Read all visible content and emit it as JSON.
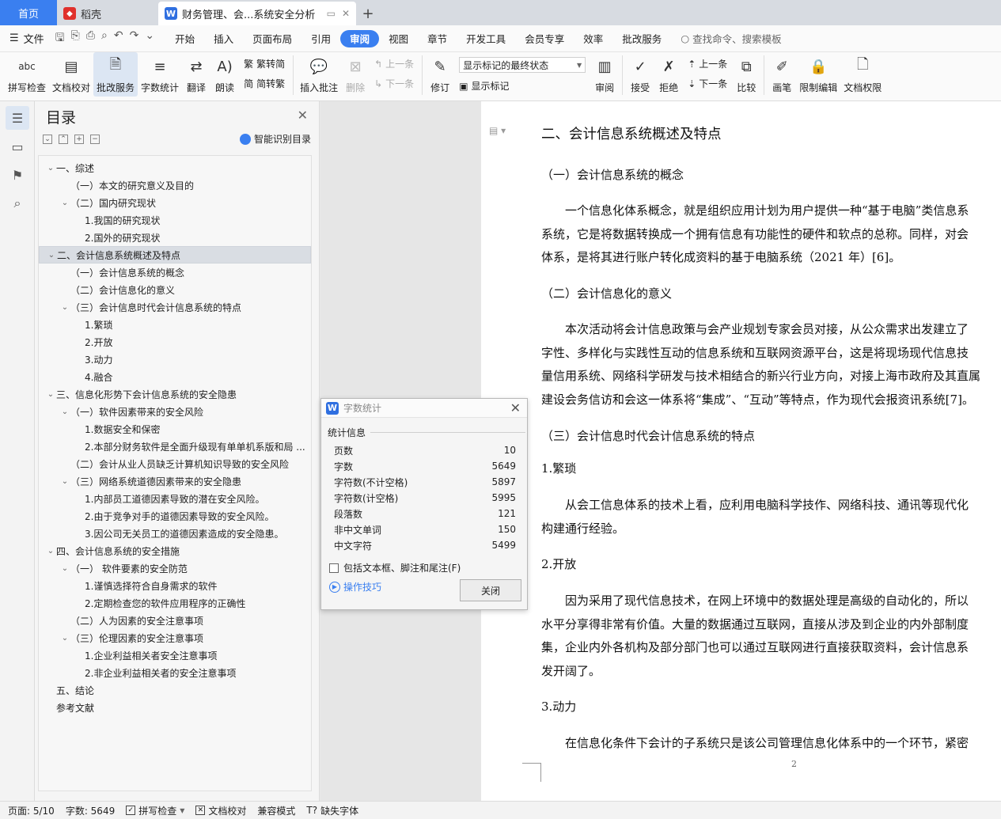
{
  "titlebar": {
    "home_tab": "首页",
    "daoke_tab": "稻壳",
    "doc_tab": "财务管理、会...系统安全分析",
    "add_tab": "+"
  },
  "menubar": {
    "file": "文件",
    "items": [
      "开始",
      "插入",
      "页面布局",
      "引用",
      "审阅",
      "视图",
      "章节",
      "开发工具",
      "会员专享",
      "效率",
      "批改服务"
    ],
    "active": "审阅",
    "search": "查找命令、搜索模板"
  },
  "ribbon": {
    "spellcheck": "拼写检查",
    "doc_proof": "文档校对",
    "grading": "批改服务",
    "word_count": "字数统计",
    "translate": "翻译",
    "read_aloud": "朗读",
    "trad": "繁转简",
    "simp": "简转繁",
    "insert_comment": "插入批注",
    "delete": "删除",
    "prev": "上一条",
    "next": "下一条",
    "revise": "修订",
    "markup_combo": "显示标记的最终状态",
    "show_markup": "显示标记",
    "review": "审阅",
    "accept": "接受",
    "reject": "拒绝",
    "prev2": "上一条",
    "next2": "下一条",
    "compare": "比较",
    "pen": "画笔",
    "restrict": "限制编辑",
    "doc_perm": "文档权限",
    "spell_icon": "abc"
  },
  "toc": {
    "title": "目录",
    "ai": "智能识别目录",
    "items": [
      {
        "level": 0,
        "caret": "v",
        "text": "一、综述"
      },
      {
        "level": 1,
        "caret": "",
        "text": "（一）本文的研究意义及目的"
      },
      {
        "level": 1,
        "caret": "v",
        "text": "（二）国内研究现状"
      },
      {
        "level": 2,
        "caret": "",
        "text": "1.我国的研究现状"
      },
      {
        "level": 2,
        "caret": "",
        "text": "2.国外的研究现状"
      },
      {
        "level": 0,
        "caret": "v",
        "text": "二、会计信息系统概述及特点",
        "selected": true
      },
      {
        "level": 1,
        "caret": "",
        "text": "（一）会计信息系统的概念"
      },
      {
        "level": 1,
        "caret": "",
        "text": "（二）会计信息化的意义"
      },
      {
        "level": 1,
        "caret": "v",
        "text": "（三）会计信息时代会计信息系统的特点"
      },
      {
        "level": 2,
        "caret": "",
        "text": "1.繁琐"
      },
      {
        "level": 2,
        "caret": "",
        "text": "2.开放"
      },
      {
        "level": 2,
        "caret": "",
        "text": "3.动力"
      },
      {
        "level": 2,
        "caret": "",
        "text": "4.融合"
      },
      {
        "level": 0,
        "caret": "v",
        "text": "三、信息化形势下会计信息系统的安全隐患"
      },
      {
        "level": 1,
        "caret": "v",
        "text": "（一）软件因素带来的安全风险"
      },
      {
        "level": 2,
        "caret": "",
        "text": "1.数据安全和保密"
      },
      {
        "level": 2,
        "caret": "",
        "text": "2.本部分财务软件是全面升级现有单单机系版和局 ..."
      },
      {
        "level": 1,
        "caret": "",
        "text": "（二）会计从业人员缺乏计算机知识导致的安全风险"
      },
      {
        "level": 1,
        "caret": "v",
        "text": "（三）网络系统道德因素带来的安全隐患"
      },
      {
        "level": 2,
        "caret": "",
        "text": "1.内部员工道德因素导致的潜在安全风险。"
      },
      {
        "level": 2,
        "caret": "",
        "text": "2.由于竞争对手的道德因素导致的安全风险。"
      },
      {
        "level": 2,
        "caret": "",
        "text": "3.因公司无关员工的道德因素造成的安全隐患。"
      },
      {
        "level": 0,
        "caret": "v",
        "text": "四、会计信息系统的安全措施"
      },
      {
        "level": 1,
        "caret": "v",
        "text": "（一）  软件要素的安全防范"
      },
      {
        "level": 2,
        "caret": "",
        "text": "1.谨慎选择符合自身需求的软件"
      },
      {
        "level": 2,
        "caret": "",
        "text": "2.定期检查您的软件应用程序的正确性"
      },
      {
        "level": 1,
        "caret": "",
        "text": "（二）人为因素的安全注意事项"
      },
      {
        "level": 1,
        "caret": "v",
        "text": "（三）伦理因素的安全注意事项"
      },
      {
        "level": 2,
        "caret": "",
        "text": "1.企业利益相关者安全注意事项"
      },
      {
        "level": 2,
        "caret": "",
        "text": "2.非企业利益相关者的安全注意事项"
      },
      {
        "level": 0,
        "caret": "",
        "text": "五、结论"
      },
      {
        "level": 0,
        "caret": "",
        "text": "参考文献"
      }
    ]
  },
  "document": {
    "h2": "二、会计信息系统概述及特点",
    "s1": "（一）会计信息系统的概念",
    "p1": [
      "一个信息化体系概念，就是组织应用计划为用户提供一种“基于电脑”类信息系",
      "系统，它是将数据转换成一个拥有信息有功能性的硬件和软点的总称。同样，对会",
      "体系，是将其进行账户转化成资料的基于电脑系统（2021 年）[6]。"
    ],
    "s2": "（二）会计信息化的意义",
    "p2": [
      "本次活动将会计信息政策与会产业规划专家会员对接，从公众需求出发建立了",
      "字性、多样化与实践性互动的信息系统和互联网资源平台，这是将现场现代信息技",
      "量信用系统、网络科学研发与技术相结合的新兴行业方向，对接上海市政府及其直属",
      "建设会务信访和会这一体系将“集成”、“互动”等特点，作为现代会报资讯系统[7]。"
    ],
    "s3": "（三）会计信息时代会计信息系统的特点",
    "t1": "1.繁琐",
    "p3": [
      "从会工信息体系的技术上看，应利用电脑科学技作、网络科技、通讯等现代化",
      "构建通行经验。"
    ],
    "t2": "2.开放",
    "p4": [
      "因为采用了现代信息技术，在网上环境中的数据处理是高级的自动化的，所以",
      "水平分享得非常有价值。大量的数据通过互联网，直接从涉及到企业的内外部制度",
      "集，企业内外各机构及部分部门也可以通过互联网进行直接获取资料，会计信息系",
      "发开阔了。"
    ],
    "t3": "3.动力",
    "p5": [
      "在信息化条件下会计的子系统只是该公司管理信息化体系中的一个环节，紧密"
    ],
    "page_number": "2"
  },
  "dialog": {
    "title": "字数统计",
    "section": "统计信息",
    "stats": [
      {
        "label": "页数",
        "value": "10"
      },
      {
        "label": "字数",
        "value": "5649"
      },
      {
        "label": "字符数(不计空格)",
        "value": "5897"
      },
      {
        "label": "字符数(计空格)",
        "value": "5995"
      },
      {
        "label": "段落数",
        "value": "121"
      },
      {
        "label": "非中文单词",
        "value": "150"
      },
      {
        "label": "中文字符",
        "value": "5499"
      }
    ],
    "checkbox": "包括文本框、脚注和尾注(F)",
    "tips": "操作技巧",
    "close": "关闭"
  },
  "statusbar": {
    "page": "页面: 5/10",
    "words": "字数: 5649",
    "spell": "拼写检查",
    "proof": "文档校对",
    "compat": "兼容模式",
    "missing_font": "缺失字体"
  }
}
